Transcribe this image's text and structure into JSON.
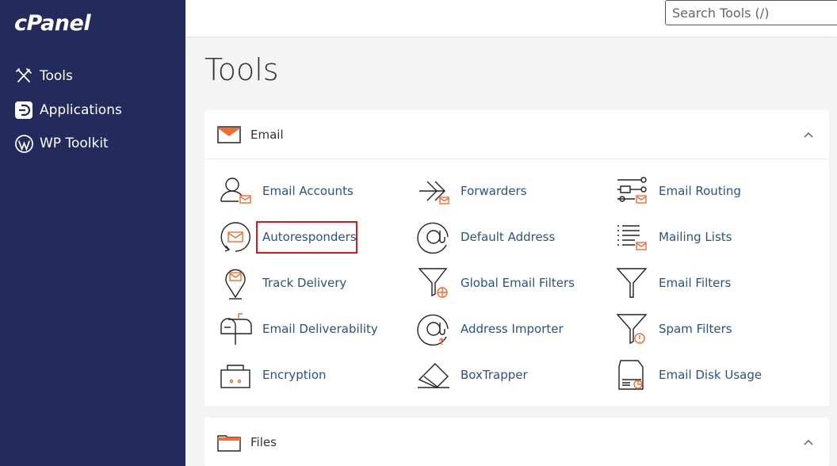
{
  "brand": {
    "logo": "cPanel"
  },
  "sidebar": {
    "items": [
      {
        "label": "Tools",
        "icon": "tools-icon"
      },
      {
        "label": "Applications",
        "icon": "applications-icon"
      },
      {
        "label": "WP Toolkit",
        "icon": "wordpress-icon"
      }
    ]
  },
  "header": {
    "search_placeholder": "Search Tools (/)"
  },
  "main": {
    "title": "Tools",
    "sections": [
      {
        "title": "Email",
        "icon": "envelope-icon",
        "tools": [
          {
            "label": "Email Accounts",
            "icon": "email-accounts-icon"
          },
          {
            "label": "Forwarders",
            "icon": "forwarders-icon"
          },
          {
            "label": "Email Routing",
            "icon": "email-routing-icon"
          },
          {
            "label": "Autoresponders",
            "icon": "autoresponders-icon"
          },
          {
            "label": "Default Address",
            "icon": "default-address-icon"
          },
          {
            "label": "Mailing Lists",
            "icon": "mailing-lists-icon"
          },
          {
            "label": "Track Delivery",
            "icon": "track-delivery-icon"
          },
          {
            "label": "Global Email Filters",
            "icon": "global-email-filters-icon"
          },
          {
            "label": "Email Filters",
            "icon": "email-filters-icon"
          },
          {
            "label": "Email Deliverability",
            "icon": "email-deliverability-icon"
          },
          {
            "label": "Address Importer",
            "icon": "address-importer-icon"
          },
          {
            "label": "Spam Filters",
            "icon": "spam-filters-icon"
          },
          {
            "label": "Encryption",
            "icon": "encryption-icon"
          },
          {
            "label": "BoxTrapper",
            "icon": "boxtrapper-icon"
          },
          {
            "label": "Email Disk Usage",
            "icon": "email-disk-usage-icon"
          }
        ]
      },
      {
        "title": "Files",
        "icon": "folder-icon"
      }
    ]
  },
  "colors": {
    "sidebar": "#232a5c",
    "link": "#295286",
    "accent": "#f26c33",
    "highlight": "#e0141a"
  }
}
